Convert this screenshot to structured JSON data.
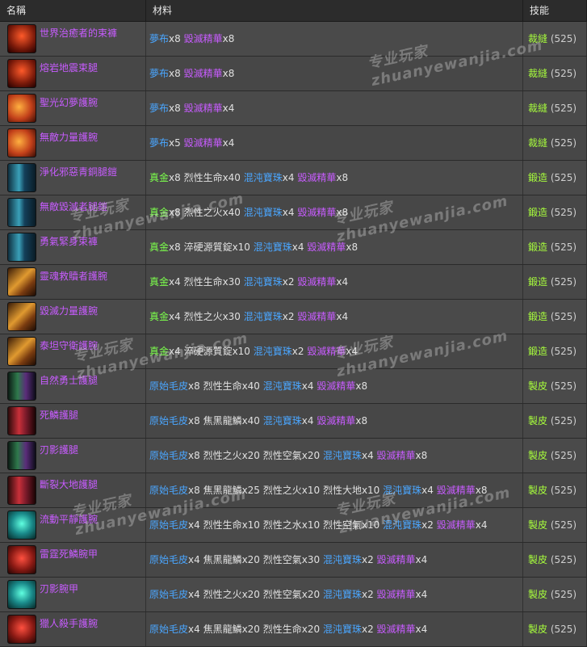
{
  "header": {
    "name": "名稱",
    "materials": "材料",
    "skill": "技能"
  },
  "colors": {
    "purple": "#c85cff",
    "blue": "#4aa6ff",
    "green": "#7cff4c",
    "white": "#e0e0e0",
    "skill": "#a8ff3c"
  },
  "rows": [
    {
      "name": "世界治癒者的束褲",
      "icon": "pants-red-icon",
      "skill": "裁縫",
      "level": "(525)",
      "mats": [
        {
          "t": "夢布",
          "c": "blue"
        },
        {
          "t": "x8 ",
          "c": "white"
        },
        {
          "t": "毀滅精華",
          "c": "purple"
        },
        {
          "t": "x8",
          "c": "white"
        }
      ]
    },
    {
      "name": "熔岩地震束腿",
      "icon": "pants-red-icon",
      "skill": "裁縫",
      "level": "(525)",
      "mats": [
        {
          "t": "夢布",
          "c": "blue"
        },
        {
          "t": "x8 ",
          "c": "white"
        },
        {
          "t": "毀滅精華",
          "c": "purple"
        },
        {
          "t": "x8",
          "c": "white"
        }
      ]
    },
    {
      "name": "聖光幻夢護腕",
      "icon": "bracer-orange-icon",
      "skill": "裁縫",
      "level": "(525)",
      "mats": [
        {
          "t": "夢布",
          "c": "blue"
        },
        {
          "t": "x8 ",
          "c": "white"
        },
        {
          "t": "毀滅精華",
          "c": "purple"
        },
        {
          "t": "x4",
          "c": "white"
        }
      ]
    },
    {
      "name": "無敵力量護腕",
      "icon": "bracer-orange-icon",
      "skill": "裁縫",
      "level": "(525)",
      "mats": [
        {
          "t": "夢布",
          "c": "blue"
        },
        {
          "t": "x5 ",
          "c": "white"
        },
        {
          "t": "毀滅精華",
          "c": "purple"
        },
        {
          "t": "x4",
          "c": "white"
        }
      ]
    },
    {
      "name": "淨化邪惡青銅腿鎧",
      "icon": "legplate-teal-icon",
      "skill": "鍛造",
      "level": "(525)",
      "mats": [
        {
          "t": "真金",
          "c": "green"
        },
        {
          "t": "x8 烈性生命x40 ",
          "c": "white"
        },
        {
          "t": "混沌寶珠",
          "c": "blue"
        },
        {
          "t": "x4 ",
          "c": "white"
        },
        {
          "t": "毀滅精華",
          "c": "purple"
        },
        {
          "t": "x8",
          "c": "white"
        }
      ]
    },
    {
      "name": "無敵毀滅者腿鎧",
      "icon": "legplate-teal-icon",
      "skill": "鍛造",
      "level": "(525)",
      "mats": [
        {
          "t": "真金",
          "c": "green"
        },
        {
          "t": "x8 烈性之火x40 ",
          "c": "white"
        },
        {
          "t": "混沌寶珠",
          "c": "blue"
        },
        {
          "t": "x4 ",
          "c": "white"
        },
        {
          "t": "毀滅精華",
          "c": "purple"
        },
        {
          "t": "x8",
          "c": "white"
        }
      ]
    },
    {
      "name": "勇氣緊身束褲",
      "icon": "legplate-teal-icon",
      "skill": "鍛造",
      "level": "(525)",
      "mats": [
        {
          "t": "真金",
          "c": "green"
        },
        {
          "t": "x8 淬硬源質錠x10 ",
          "c": "white"
        },
        {
          "t": "混沌寶珠",
          "c": "blue"
        },
        {
          "t": "x4 ",
          "c": "white"
        },
        {
          "t": "毀滅精華",
          "c": "purple"
        },
        {
          "t": "x8",
          "c": "white"
        }
      ]
    },
    {
      "name": "靈魂救贖者護腕",
      "icon": "bracer-gold-icon",
      "skill": "鍛造",
      "level": "(525)",
      "mats": [
        {
          "t": "真金",
          "c": "green"
        },
        {
          "t": "x4 烈性生命x30 ",
          "c": "white"
        },
        {
          "t": "混沌寶珠",
          "c": "blue"
        },
        {
          "t": "x2 ",
          "c": "white"
        },
        {
          "t": "毀滅精華",
          "c": "purple"
        },
        {
          "t": "x4",
          "c": "white"
        }
      ]
    },
    {
      "name": "毀滅力量護腕",
      "icon": "bracer-gold-icon",
      "skill": "鍛造",
      "level": "(525)",
      "mats": [
        {
          "t": "真金",
          "c": "green"
        },
        {
          "t": "x4 烈性之火x30 ",
          "c": "white"
        },
        {
          "t": "混沌寶珠",
          "c": "blue"
        },
        {
          "t": "x2 ",
          "c": "white"
        },
        {
          "t": "毀滅精華",
          "c": "purple"
        },
        {
          "t": "x4",
          "c": "white"
        }
      ]
    },
    {
      "name": "泰坦守衛護腕",
      "icon": "bracer-gold-icon",
      "skill": "鍛造",
      "level": "(525)",
      "mats": [
        {
          "t": "真金",
          "c": "green"
        },
        {
          "t": "x4 淬硬源質錠x10 ",
          "c": "white"
        },
        {
          "t": "混沌寶珠",
          "c": "blue"
        },
        {
          "t": "x2 ",
          "c": "white"
        },
        {
          "t": "毀滅精華",
          "c": "purple"
        },
        {
          "t": "x4",
          "c": "white"
        }
      ]
    },
    {
      "name": "自然勇士護腿",
      "icon": "legs-green-icon",
      "skill": "製皮",
      "level": "(525)",
      "mats": [
        {
          "t": "原始毛皮",
          "c": "blue"
        },
        {
          "t": "x8 烈性生命x40 ",
          "c": "white"
        },
        {
          "t": "混沌寶珠",
          "c": "blue"
        },
        {
          "t": "x4 ",
          "c": "white"
        },
        {
          "t": "毀滅精華",
          "c": "purple"
        },
        {
          "t": "x8",
          "c": "white"
        }
      ]
    },
    {
      "name": "死鱗護腿",
      "icon": "legs-red-icon",
      "skill": "製皮",
      "level": "(525)",
      "mats": [
        {
          "t": "原始毛皮",
          "c": "blue"
        },
        {
          "t": "x8 焦黑龍鱗x40 ",
          "c": "white"
        },
        {
          "t": "混沌寶珠",
          "c": "blue"
        },
        {
          "t": "x4 ",
          "c": "white"
        },
        {
          "t": "毀滅精華",
          "c": "purple"
        },
        {
          "t": "x8",
          "c": "white"
        }
      ]
    },
    {
      "name": "刃影護腿",
      "icon": "legs-green-icon",
      "skill": "製皮",
      "level": "(525)",
      "mats": [
        {
          "t": "原始毛皮",
          "c": "blue"
        },
        {
          "t": "x8 烈性之火x20 烈性空氣x20 ",
          "c": "white"
        },
        {
          "t": "混沌寶珠",
          "c": "blue"
        },
        {
          "t": "x4 ",
          "c": "white"
        },
        {
          "t": "毀滅精華",
          "c": "purple"
        },
        {
          "t": "x8",
          "c": "white"
        }
      ]
    },
    {
      "name": "斷裂大地護腿",
      "icon": "legs-red-icon",
      "skill": "製皮",
      "level": "(525)",
      "mats": [
        {
          "t": "原始毛皮",
          "c": "blue"
        },
        {
          "t": "x8 焦黑龍鱗x25 烈性之火x10 烈性大地x10 ",
          "c": "white"
        },
        {
          "t": "混沌寶珠",
          "c": "blue"
        },
        {
          "t": "x4 ",
          "c": "white"
        },
        {
          "t": "毀滅精華",
          "c": "purple"
        },
        {
          "t": "x8",
          "c": "white"
        }
      ]
    },
    {
      "name": "流動平靜護腕",
      "icon": "bracer-teal-icon",
      "skill": "製皮",
      "level": "(525)",
      "mats": [
        {
          "t": "原始毛皮",
          "c": "blue"
        },
        {
          "t": "x4 烈性生命x10 烈性之水x10 烈性空氣x10 ",
          "c": "white"
        },
        {
          "t": "混沌寶珠",
          "c": "blue"
        },
        {
          "t": "x2 ",
          "c": "white"
        },
        {
          "t": "毀滅精華",
          "c": "purple"
        },
        {
          "t": "x4",
          "c": "white"
        }
      ]
    },
    {
      "name": "雷霆死鱗腕甲",
      "icon": "bracer-red-icon",
      "skill": "製皮",
      "level": "(525)",
      "mats": [
        {
          "t": "原始毛皮",
          "c": "blue"
        },
        {
          "t": "x4 焦黑龍鱗x20 烈性空氣x30 ",
          "c": "white"
        },
        {
          "t": "混沌寶珠",
          "c": "blue"
        },
        {
          "t": "x2 ",
          "c": "white"
        },
        {
          "t": "毀滅精華",
          "c": "purple"
        },
        {
          "t": "x4",
          "c": "white"
        }
      ]
    },
    {
      "name": "刃影腕甲",
      "icon": "bracer-teal-icon",
      "skill": "製皮",
      "level": "(525)",
      "mats": [
        {
          "t": "原始毛皮",
          "c": "blue"
        },
        {
          "t": "x4 烈性之火x20 烈性空氣x20 ",
          "c": "white"
        },
        {
          "t": "混沌寶珠",
          "c": "blue"
        },
        {
          "t": "x2 ",
          "c": "white"
        },
        {
          "t": "毀滅精華",
          "c": "purple"
        },
        {
          "t": "x4",
          "c": "white"
        }
      ]
    },
    {
      "name": "獵人殺手護腕",
      "icon": "bracer-red-icon",
      "skill": "製皮",
      "level": "(525)",
      "mats": [
        {
          "t": "原始毛皮",
          "c": "blue"
        },
        {
          "t": "x4 焦黑龍鱗x20 烈性生命x20 ",
          "c": "white"
        },
        {
          "t": "混沌寶珠",
          "c": "blue"
        },
        {
          "t": "x2 ",
          "c": "white"
        },
        {
          "t": "毀滅精華",
          "c": "purple"
        },
        {
          "t": "x4",
          "c": "white"
        }
      ]
    }
  ],
  "watermark": {
    "cn": "专业玩家",
    "latin": "zhuanyewanjia.com"
  }
}
